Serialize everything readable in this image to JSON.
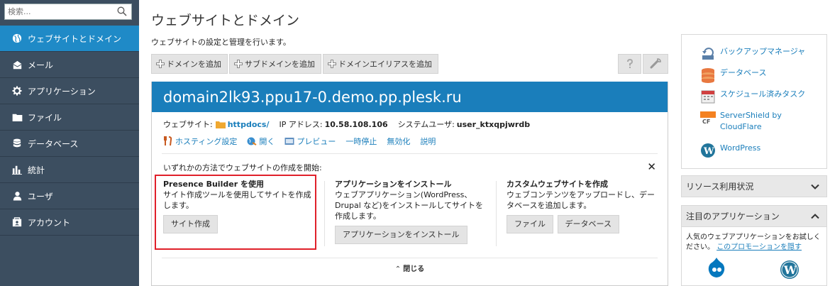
{
  "search": {
    "placeholder": "検索..."
  },
  "sidebar": {
    "items": [
      {
        "label": "ウェブサイトとドメイン",
        "icon": "globe-icon",
        "active": true
      },
      {
        "label": "メール",
        "icon": "mail-icon"
      },
      {
        "label": "アプリケーション",
        "icon": "gear-icon"
      },
      {
        "label": "ファイル",
        "icon": "folder-icon"
      },
      {
        "label": "データベース",
        "icon": "database-icon"
      },
      {
        "label": "統計",
        "icon": "bar-chart-icon"
      },
      {
        "label": "ユーザ",
        "icon": "user-icon"
      },
      {
        "label": "アカウント",
        "icon": "account-icon"
      }
    ]
  },
  "header": {
    "title": "ウェブサイトとドメイン",
    "description": "ウェブサイトの設定と管理を行います。"
  },
  "toolbar": {
    "add_domain": "ドメインを追加",
    "add_subdomain": "サブドメインを追加",
    "add_alias": "ドメインエイリアスを追加"
  },
  "domain": {
    "name": "domain2lk93.ppu17-0.demo.pp.plesk.ru",
    "website_label": "ウェブサイト:",
    "website_path": "httpdocs/",
    "ip_label": "IP アドレス:",
    "ip": "10.58.108.106",
    "sysuser_label": "システムユーザ:",
    "sysuser": "user_ktxqpjwrdb",
    "links": {
      "hosting": "ホスティング設定",
      "open": "開く",
      "preview": "プレビュー",
      "suspend": "一時停止",
      "disable": "無効化",
      "description": "説明"
    }
  },
  "start": {
    "title": "いずれかの方法でウェブサイトの作成を開始:",
    "options": {
      "presence": {
        "heading": "Presence Builder を使用",
        "text": "サイト作成ツールを使用してサイトを作成します。",
        "button": "サイト作成"
      },
      "apps": {
        "heading": "アプリケーションをインストール",
        "text": "ウェブアプリケーション(WordPress、Drupal など)をインストールしてサイトを作成します。",
        "button": "アプリケーションをインストール"
      },
      "custom": {
        "heading": "カスタムウェブサイトを作成",
        "text": "ウェブコンテンツをアップロードし、データベースを追加します。",
        "button_files": "ファイル",
        "button_db": "データベース"
      }
    },
    "collapse": "閉じる"
  },
  "right": {
    "items": {
      "backup": "バックアップマネージャ",
      "databases": "データベース",
      "scheduled": "スケジュール済みタスク",
      "servershield": "ServerShield by CloudFlare",
      "wordpress": "WordPress"
    },
    "resource_usage": "リソース利用状況",
    "featured": {
      "title": "注目のアプリケーション",
      "text": "人気のウェブアプリケーションをお試しください。",
      "hide_link": "このプロモーションを隠す"
    }
  },
  "colors": {
    "sidebar_bg": "#3c4e60",
    "active": "#1f8ac7",
    "domain_header": "#1a7ebb",
    "highlight": "#e0202a"
  }
}
